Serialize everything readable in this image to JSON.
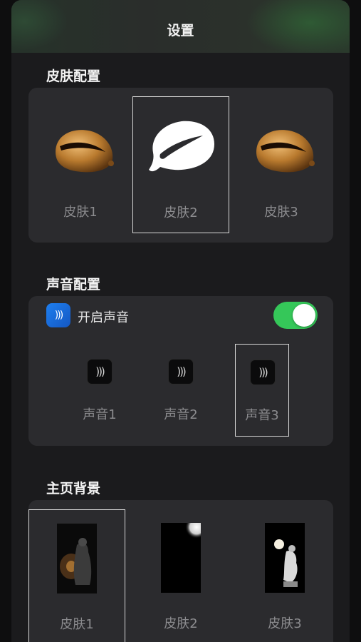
{
  "header": {
    "title": "设置"
  },
  "skins": {
    "title": "皮肤配置",
    "options": [
      {
        "label": "皮肤1",
        "style": "wooden-fish-brown",
        "selected": false
      },
      {
        "label": "皮肤2",
        "style": "wooden-fish-white",
        "selected": true
      },
      {
        "label": "皮肤3",
        "style": "wooden-fish-brown",
        "selected": false
      }
    ]
  },
  "sound": {
    "title": "声音配置",
    "enable_label": "开启声音",
    "enabled": true,
    "icon_glyph": ")))",
    "options": [
      {
        "label": "声音1",
        "selected": false
      },
      {
        "label": "声音2",
        "selected": false
      },
      {
        "label": "声音3",
        "selected": true
      }
    ]
  },
  "background": {
    "title": "主页背景",
    "options": [
      {
        "label": "皮肤1",
        "selected": true
      },
      {
        "label": "皮肤2",
        "selected": false
      },
      {
        "label": "皮肤3",
        "selected": false
      }
    ]
  },
  "colors": {
    "accent_toggle": "#35c759",
    "sheet": "#1b1b1d",
    "card": "#2b2b2e",
    "label_muted": "#8b8b8e"
  }
}
